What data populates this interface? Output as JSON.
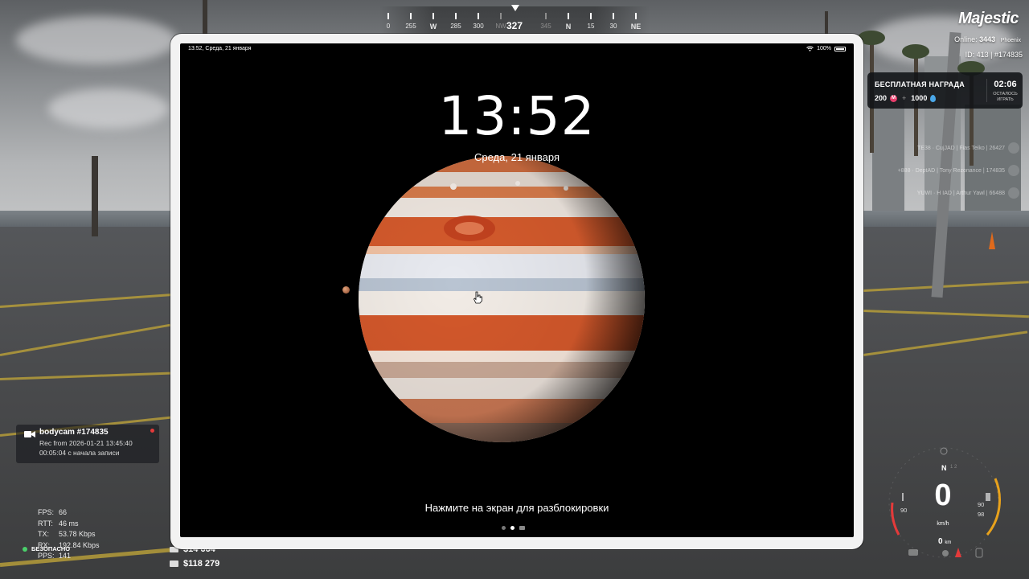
{
  "compass": {
    "heading": "327",
    "labels": [
      {
        "text": "0",
        "pos": 0
      },
      {
        "text": "255",
        "pos": 1
      },
      {
        "text": "W",
        "pos": 2,
        "cardinal": true
      },
      {
        "text": "285",
        "pos": 3
      },
      {
        "text": "300",
        "pos": 4
      },
      {
        "text": "NW",
        "pos": 5,
        "dim": true
      },
      {
        "text": "345",
        "pos": 7,
        "dim": true
      },
      {
        "text": "N",
        "pos": 8,
        "cardinal": true
      },
      {
        "text": "15",
        "pos": 9
      },
      {
        "text": "30",
        "pos": 10
      },
      {
        "text": "NE",
        "pos": 11,
        "cardinal": true
      }
    ]
  },
  "server": {
    "brand": "Majestic",
    "online_label": "Online:",
    "online_count": "3443",
    "server_name": "Phoenix",
    "ids": "ID: 413 | #174835"
  },
  "reward": {
    "title": "БЕСПЛАТНАЯ НАГРАДА",
    "amount_coins": "200",
    "plus": "+",
    "amount_drops": "1000",
    "time": "02:06",
    "time_left_label": "ОСТАЛОСЬ ИГРАТЬ"
  },
  "kill_feed": [
    "TE38 · CujJAD | Fias Teiko | 26427",
    "+888 · DeptAD | Tony Rezonance | 174835",
    "YUWI · H IAD | Arthur Yawl | 66488"
  ],
  "bodycam": {
    "title": "bodycam #174835",
    "rec": "Rec from 2026-01-21 13:45:40",
    "elapsed": "00:05:04 с начала записи"
  },
  "netstats": {
    "rows": [
      {
        "label": "FPS:",
        "value": "66"
      },
      {
        "label": "RTT:",
        "value": "46 ms"
      },
      {
        "label": "TX:",
        "value": "53.78 Kbps"
      },
      {
        "label": "RX:",
        "value": "192.84 Kbps"
      },
      {
        "label": "PPS:",
        "value": "141"
      }
    ],
    "safe_label": "БЕЗОПАСНО"
  },
  "money": {
    "cash": "$14 664",
    "bank": "$118 279"
  },
  "speedo": {
    "speed": "0",
    "unit": "km/h",
    "gear": "N",
    "gear_next": "1  2",
    "left_val": "90",
    "right_val_top": "90",
    "right_val_bottom": "98",
    "km": "0",
    "km_unit": "km"
  },
  "tablet": {
    "status_time": "13:52, Среда, 21 января",
    "battery": "100%",
    "lock_time": "13:52",
    "lock_date": "Среда, 21 января",
    "unlock_hint": "Нажмите на экран для разблокировки"
  },
  "colors": {
    "accent_red": "#e43a3a",
    "safe_green": "#4ad06b",
    "gauge_orange": "#e8a21c"
  }
}
